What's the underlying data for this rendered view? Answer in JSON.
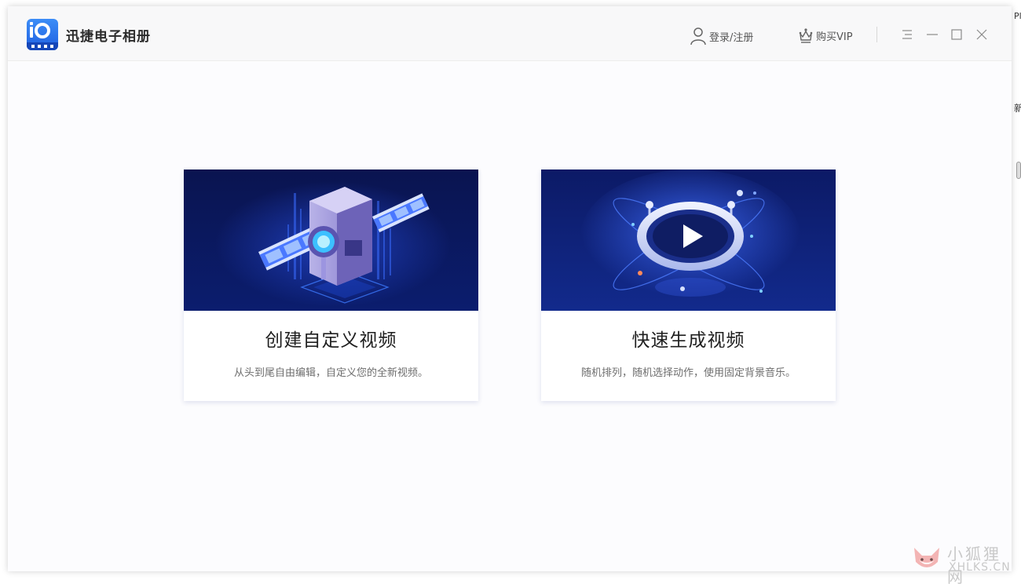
{
  "app": {
    "title": "迅捷电子相册"
  },
  "header": {
    "login_label": "登录/注册",
    "vip_label": "购买VIP"
  },
  "cards": [
    {
      "title": "创建自定义视频",
      "description": "从头到尾自由编辑，自定义您的全新视频。"
    },
    {
      "title": "快速生成视频",
      "description": "随机排列，随机选择动作，使用固定背景音乐。"
    }
  ],
  "edge_text": {
    "top": "Pl",
    "middle": "新"
  },
  "watermark": {
    "cn": "小狐狸网",
    "en": "XHLKS.CN"
  },
  "colors": {
    "brand": "#2f7bf0",
    "card_bg_dark": "#0d1a5c",
    "accent": "#3a6cff"
  },
  "icons": [
    "user-icon",
    "crown-icon",
    "menu-icon",
    "minimize-icon",
    "maximize-icon",
    "close-icon",
    "play-icon"
  ]
}
